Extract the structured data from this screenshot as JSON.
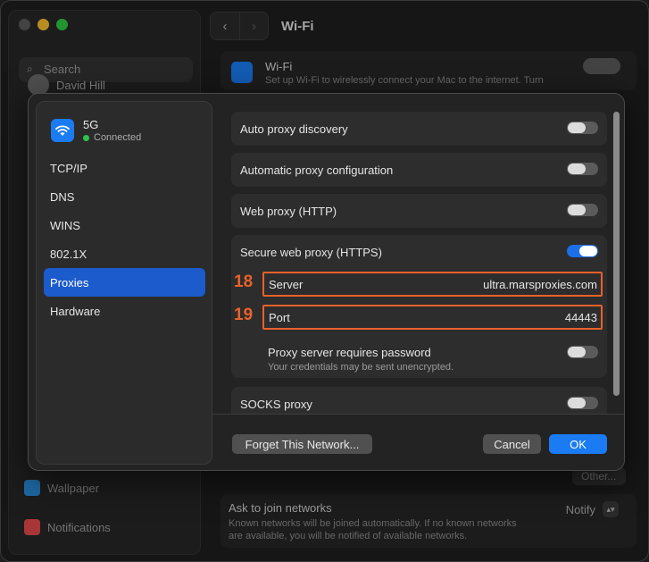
{
  "background": {
    "sidebar": {
      "search_placeholder": "Search",
      "user_name": "David Hill",
      "wallpaper_label": "Wallpaper",
      "notifications_label": "Notifications"
    },
    "main": {
      "title": "Wi-Fi",
      "wifi_card_title": "Wi-Fi",
      "wifi_card_desc": "Set up Wi-Fi to wirelessly connect your Mac to the internet. Turn",
      "other_button": "Other...",
      "ask_title": "Ask to join networks",
      "ask_desc": "Known networks will be joined automatically. If no known networks are available, you will be notified of available networks.",
      "ask_value": "Notify"
    }
  },
  "modal": {
    "network": {
      "name": "5G",
      "status": "Connected"
    },
    "nav": [
      {
        "label": "TCP/IP"
      },
      {
        "label": "DNS"
      },
      {
        "label": "WINS"
      },
      {
        "label": "802.1X"
      },
      {
        "label": "Proxies",
        "active": true
      },
      {
        "label": "Hardware"
      }
    ],
    "rows": {
      "auto_discovery": {
        "label": "Auto proxy discovery",
        "on": false
      },
      "auto_config": {
        "label": "Automatic proxy configuration",
        "on": false
      },
      "web_proxy": {
        "label": "Web proxy (HTTP)",
        "on": false
      },
      "secure_proxy": {
        "label": "Secure web proxy (HTTPS)",
        "on": true
      },
      "socks_proxy": {
        "label": "SOCKS proxy",
        "on": false
      }
    },
    "server": {
      "marker": "18",
      "label": "Server",
      "value": "ultra.marsproxies.com"
    },
    "port": {
      "marker": "19",
      "label": "Port",
      "value": "44443"
    },
    "password": {
      "label": "Proxy server requires password",
      "desc": "Your credentials may be sent unencrypted.",
      "on": false
    },
    "buttons": {
      "forget": "Forget This Network...",
      "cancel": "Cancel",
      "ok": "OK"
    }
  },
  "colors": {
    "accent": "#1a7bf2",
    "highlight": "#e8612a",
    "connected": "#31c252"
  }
}
